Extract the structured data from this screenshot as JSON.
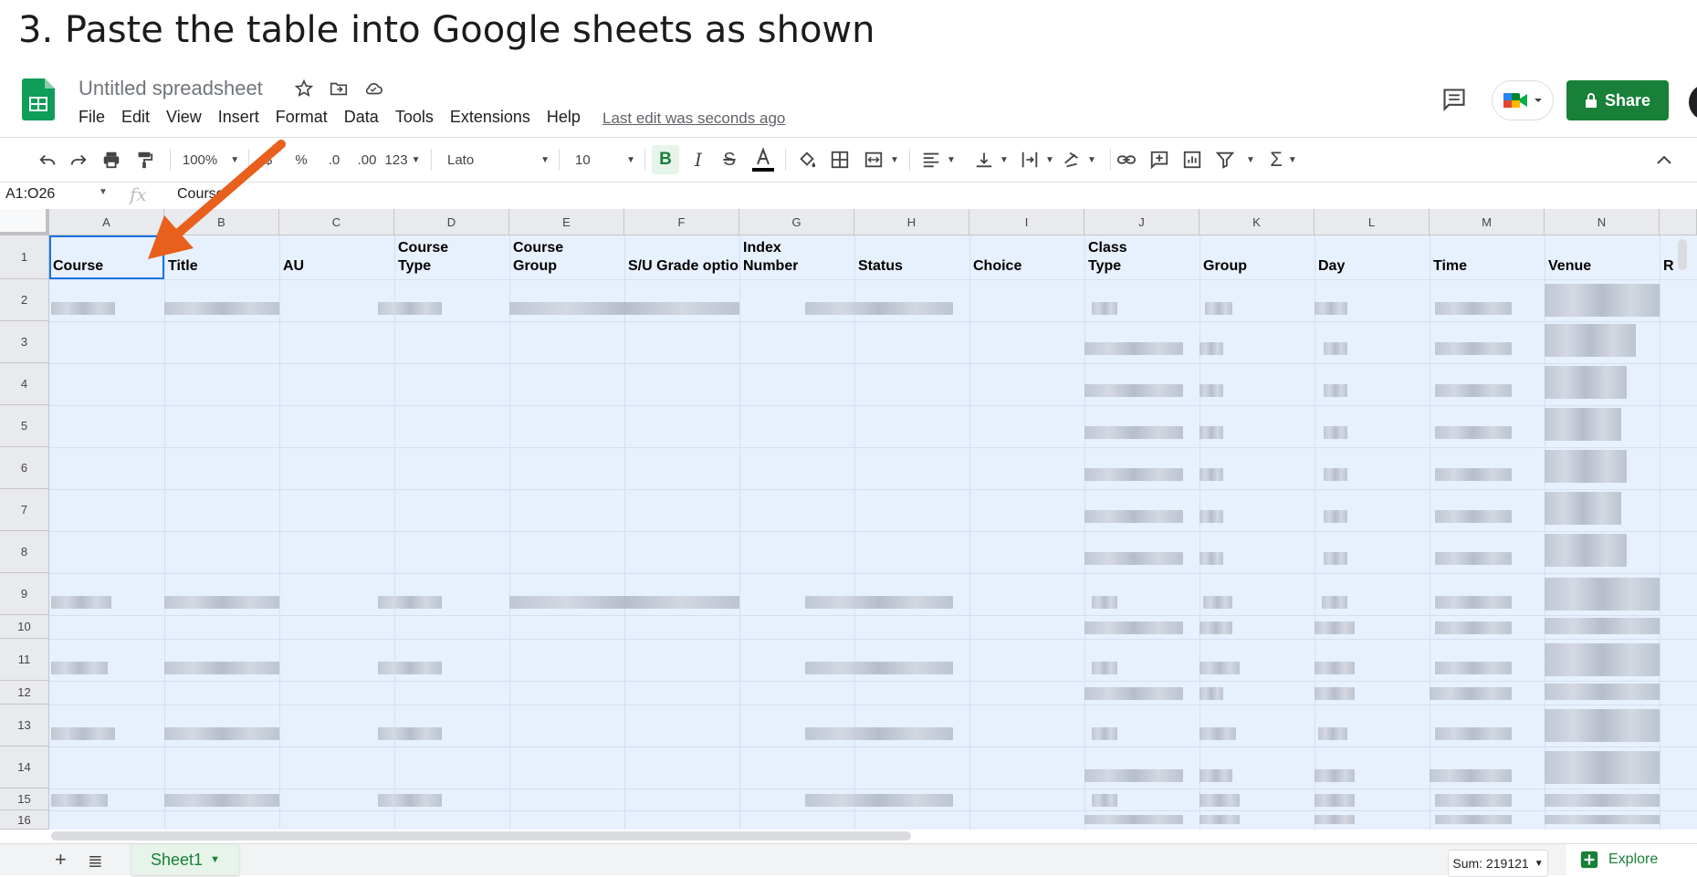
{
  "heading": "3. Paste the table into Google sheets as shown",
  "doc_title": "Untitled spreadsheet",
  "menu": [
    "File",
    "Edit",
    "View",
    "Insert",
    "Format",
    "Data",
    "Tools",
    "Extensions",
    "Help"
  ],
  "last_edit": "Last edit was seconds ago",
  "share_label": "Share",
  "toolbar": {
    "zoom": "100%",
    "currency": "$",
    "percent": "%",
    "dec_decrease": ".0",
    "dec_increase": ".00",
    "number_format": "123",
    "font": "Lato",
    "font_size": "10"
  },
  "formula_bar": {
    "range": "A1:O26",
    "fx": "fx",
    "value": "Course"
  },
  "columns": [
    "A",
    "B",
    "C",
    "D",
    "E",
    "F",
    "G",
    "H",
    "I",
    "J",
    "K",
    "L",
    "M",
    "N"
  ],
  "rows": [
    "1",
    "2",
    "3",
    "4",
    "5",
    "6",
    "7",
    "8",
    "9",
    "10",
    "11",
    "12",
    "13",
    "14",
    "15",
    "16"
  ],
  "headers": {
    "a": "Course",
    "b": "Title",
    "c": "AU",
    "d1": "Course",
    "d2": "Type",
    "e1": "Course",
    "e2": "Group",
    "f": "S/U Grade option",
    "g1": "Index",
    "g2": "Number",
    "h": "Status",
    "i": "Choice",
    "j1": "Class",
    "j2": "Type",
    "k": "Group",
    "l": "Day",
    "m": "Time",
    "n": "Venue",
    "o": "R"
  },
  "bottom": {
    "sheet": "Sheet1",
    "sum": "Sum: 219121",
    "explore": "Explore"
  },
  "colors": {
    "green": "#188038",
    "selection": "#e7f0fd",
    "arrow": "#e8601c"
  }
}
